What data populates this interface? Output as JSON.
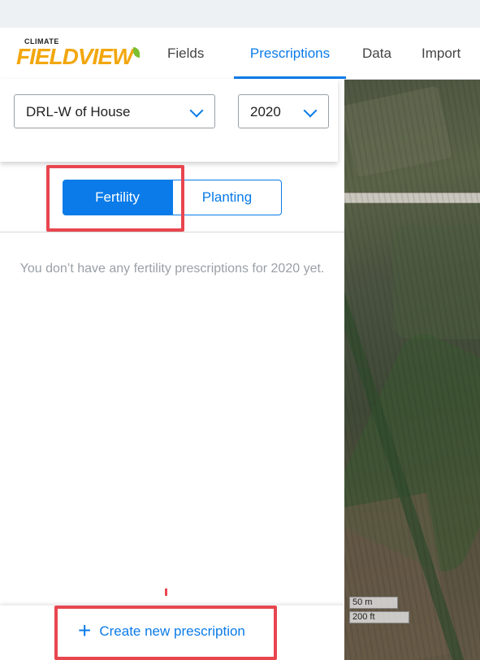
{
  "app": {
    "logo_top": "CLIMATE",
    "logo_main": "FIELDVIEW"
  },
  "nav": {
    "items": [
      {
        "label": "Fields"
      },
      {
        "label": "Prescriptions",
        "active": true
      },
      {
        "label": "Data"
      },
      {
        "label": "Import"
      }
    ]
  },
  "selectors": {
    "field": {
      "value": "DRL-W of House"
    },
    "year": {
      "value": "2020"
    }
  },
  "tabs": {
    "fertility": "Fertility",
    "planting": "Planting",
    "selected": "Fertility"
  },
  "empty_state": {
    "message": "You don’t have any fertility prescriptions for 2020 yet."
  },
  "actions": {
    "create_label": "Create new prescription",
    "create_icon": "plus-icon"
  },
  "map": {
    "scale_metric": "50 m",
    "scale_imperial": "200 ft"
  },
  "colors": {
    "accent": "#0a7be8",
    "highlight": "#e8464f",
    "logo_yellow": "#f2a70f"
  }
}
